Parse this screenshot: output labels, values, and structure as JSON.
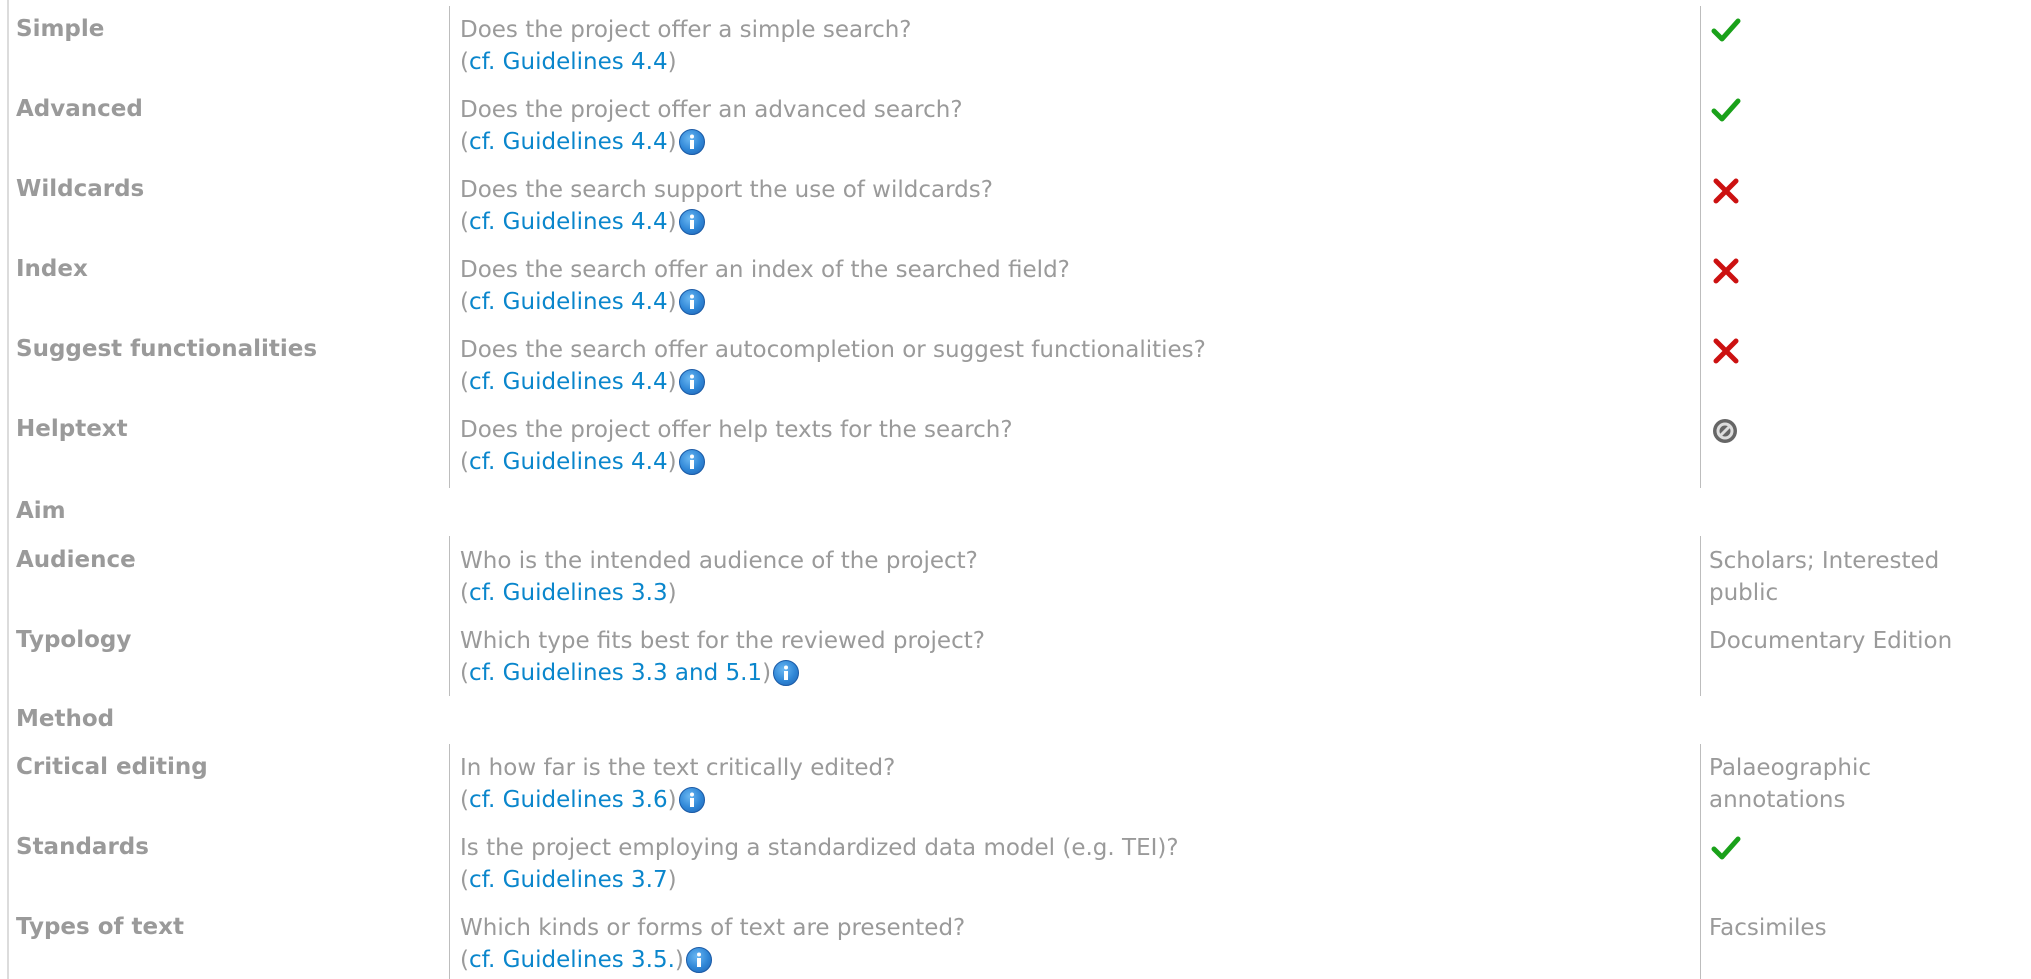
{
  "search_rows": [
    {
      "label": "Simple",
      "question": "Does the project offer a simple search?",
      "ref_open": "(",
      "ref": "cf. Guidelines 4.4",
      "ref_close": ")",
      "info": false,
      "value_icon": "check-icon"
    },
    {
      "label": "Advanced",
      "question": "Does the project offer an advanced search?",
      "ref_open": "(",
      "ref": "cf. Guidelines 4.4",
      "ref_close": ")",
      "info": true,
      "value_icon": "check-icon"
    },
    {
      "label": "Wildcards",
      "question": "Does the search support the use of wildcards?",
      "ref_open": "(",
      "ref": "cf. Guidelines 4.4",
      "ref_close": ")",
      "info": true,
      "value_icon": "cross-icon"
    },
    {
      "label": "Index",
      "question": "Does the search offer an index of the searched field?",
      "ref_open": "(",
      "ref": "cf. Guidelines 4.4",
      "ref_close": ")",
      "info": true,
      "value_icon": "cross-icon"
    },
    {
      "label": "Suggest functionalities",
      "question": "Does the search offer autocompletion or suggest functionalities?",
      "ref_open": "(",
      "ref": "cf. Guidelines 4.4",
      "ref_close": ")",
      "info": true,
      "value_icon": "cross-icon"
    },
    {
      "label": "Helptext",
      "question": "Does the project offer help texts for the search?",
      "ref_open": "(",
      "ref": "cf. Guidelines 4.4",
      "ref_close": ")",
      "info": true,
      "value_icon": "not-applicable-icon"
    }
  ],
  "aim": {
    "heading": "Aim",
    "rows": [
      {
        "label": "Audience",
        "question": "Who is the intended audience of the project?",
        "ref_open": "(",
        "ref": "cf. Guidelines 3.3",
        "ref_close": ")",
        "info": false,
        "value_line1": "Scholars; Interested",
        "value_line2": "public"
      },
      {
        "label": "Typology",
        "question": "Which type fits best for the reviewed project?",
        "ref_open": "(",
        "ref": "cf. Guidelines 3.3 and 5.1",
        "ref_close": ")",
        "info": true,
        "value_line1": "Documentary Edition",
        "value_line2": ""
      }
    ]
  },
  "method": {
    "heading": "Method",
    "rows": [
      {
        "label": "Critical editing",
        "question": "In how far is the text critically edited?",
        "ref_open": "(",
        "ref": "cf. Guidelines 3.6",
        "ref_close": ")",
        "info": true,
        "value_line1": "Palaeographic",
        "value_line2": "annotations",
        "value_icon": ""
      },
      {
        "label": "Standards",
        "question": "Is the project employing a standardized data model (e.g. TEI)?",
        "ref_open": "(",
        "ref": "cf. Guidelines 3.7",
        "ref_close": ")",
        "info": false,
        "value_line1": "",
        "value_line2": "",
        "value_icon": "check-icon"
      },
      {
        "label": "Types of text",
        "question": "Which kinds or forms of text are presented?",
        "ref_open": "(",
        "ref": "cf. Guidelines 3.5.",
        "ref_close": ")",
        "info": true,
        "value_line1": "Facsimiles",
        "value_line2": "",
        "value_icon": ""
      }
    ]
  },
  "colors": {
    "text": "#9a9a9a",
    "link": "#0a86cc",
    "check": "#1aa11a",
    "cross": "#cc1111",
    "na": "#555555"
  }
}
